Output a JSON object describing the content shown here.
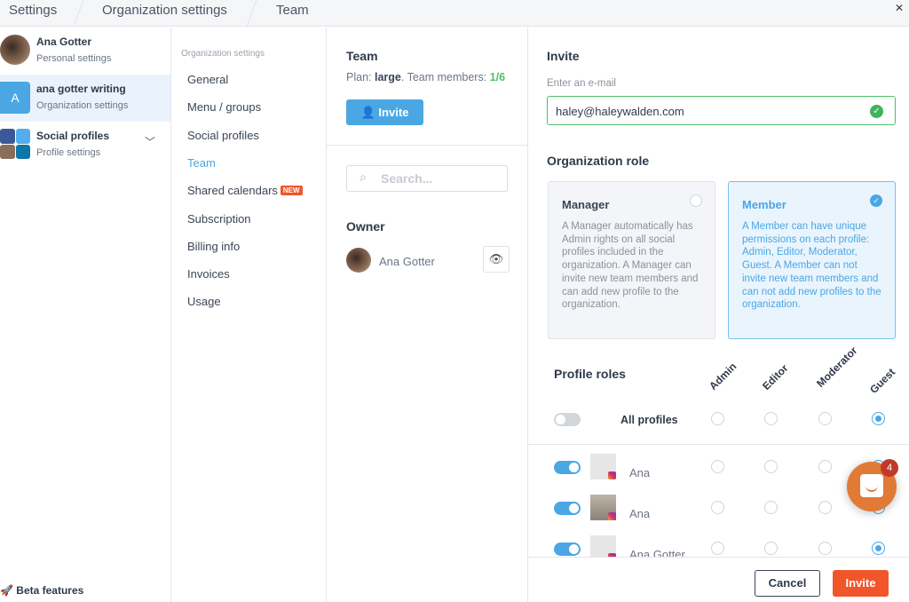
{
  "breadcrumb": [
    "Settings",
    "Organization settings",
    "Team"
  ],
  "close_icon": "close-icon",
  "accounts": [
    {
      "name": "Ana Gotter",
      "sub": "Personal settings"
    },
    {
      "name": "ana gotter writing",
      "sub": "Organization settings",
      "initial": "A"
    },
    {
      "name": "Social profiles",
      "sub": "Profile settings"
    }
  ],
  "beta": "Beta features",
  "nav": {
    "heading": "Organization settings",
    "items": [
      "General",
      "Menu / groups",
      "Social profiles",
      "Team",
      "Shared calendars",
      "Subscription",
      "Billing info",
      "Invoices",
      "Usage"
    ],
    "active": "Team",
    "new_badge": "NEW"
  },
  "team": {
    "title": "Team",
    "plan_label": "Plan: ",
    "plan": "large",
    "members_label": ". Team members: ",
    "members": "1/6",
    "invite": "Invite",
    "search_placeholder": "Search...",
    "owner_title": "Owner",
    "owner_name": "Ana Gotter"
  },
  "invite": {
    "title": "Invite",
    "email_label": "Enter an e-mail",
    "email": "haley@haleywalden.com",
    "role_title": "Organization role",
    "roles": [
      {
        "name": "Manager",
        "desc": "A Manager automatically has Admin rights on all social profiles included in the organization. A Manager can invite new team members and can add new profile to the organization.",
        "selected": false
      },
      {
        "name": "Member",
        "desc": "A Member can have unique permissions on each profile: Admin, Editor, Moderator, Guest. A Member can not invite new team members and can not add new profiles to the organization.",
        "selected": true
      }
    ],
    "profile_roles_title": "Profile roles",
    "role_columns": [
      "Admin",
      "Editor",
      "Moderator",
      "Guest"
    ],
    "all_profiles": {
      "label": "All profiles",
      "enabled": false,
      "role": "Guest"
    },
    "profiles": [
      {
        "name": "Ana",
        "enabled": true,
        "role": "Guest",
        "photo": false
      },
      {
        "name": "Ana",
        "enabled": true,
        "role": "Guest",
        "photo": true
      },
      {
        "name": "Ana Gotter",
        "enabled": true,
        "role": "Guest",
        "photo": false
      }
    ],
    "cancel": "Cancel",
    "submit": "Invite"
  },
  "chat": {
    "badge": "4"
  },
  "colors": {
    "accent": "#4aa7e3",
    "primary_action": "#f0562a",
    "success": "#3cb55a"
  }
}
